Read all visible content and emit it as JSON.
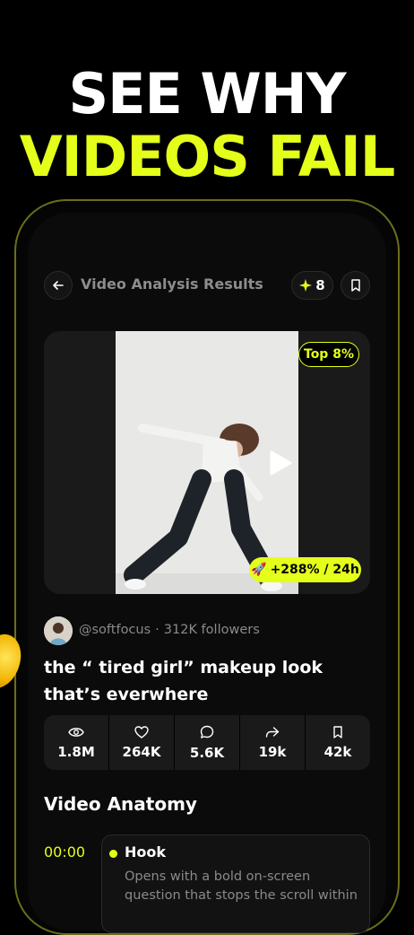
{
  "promo": {
    "line1": "SEE WHY",
    "line2": "VIDEOS FAIL"
  },
  "header": {
    "title": "Video Analysis Results",
    "credits": "8",
    "back_icon": "arrow-left-icon",
    "credits_icon": "sparkle-icon",
    "bookmark_icon": "bookmark-icon"
  },
  "video": {
    "rank_badge": "Top 8%",
    "growth_icon": "rocket-icon",
    "growth_badge": "+288% / 24h"
  },
  "creator": {
    "handle": "@softfocus",
    "separator": "·",
    "followers": "312K followers"
  },
  "post": {
    "title": "the “ tired girl” makeup look that’s everwhere"
  },
  "stats": [
    {
      "icon": "eye-icon",
      "value": "1.8M"
    },
    {
      "icon": "heart-icon",
      "value": "264K"
    },
    {
      "icon": "comment-icon",
      "value": "5.6K"
    },
    {
      "icon": "share-icon",
      "value": "19k"
    },
    {
      "icon": "bookmark-icon",
      "value": "42k"
    }
  ],
  "anatomy": {
    "section_title": "Video Anatomy",
    "segments": [
      {
        "time": "00:00",
        "title": "Hook",
        "description": "Opens with a bold on-screen question that stops the scroll within"
      }
    ]
  },
  "colors": {
    "accent": "#e4ff1a",
    "background": "#000000",
    "card": "#1a1a1a",
    "muted_text": "#8a8a8a"
  }
}
